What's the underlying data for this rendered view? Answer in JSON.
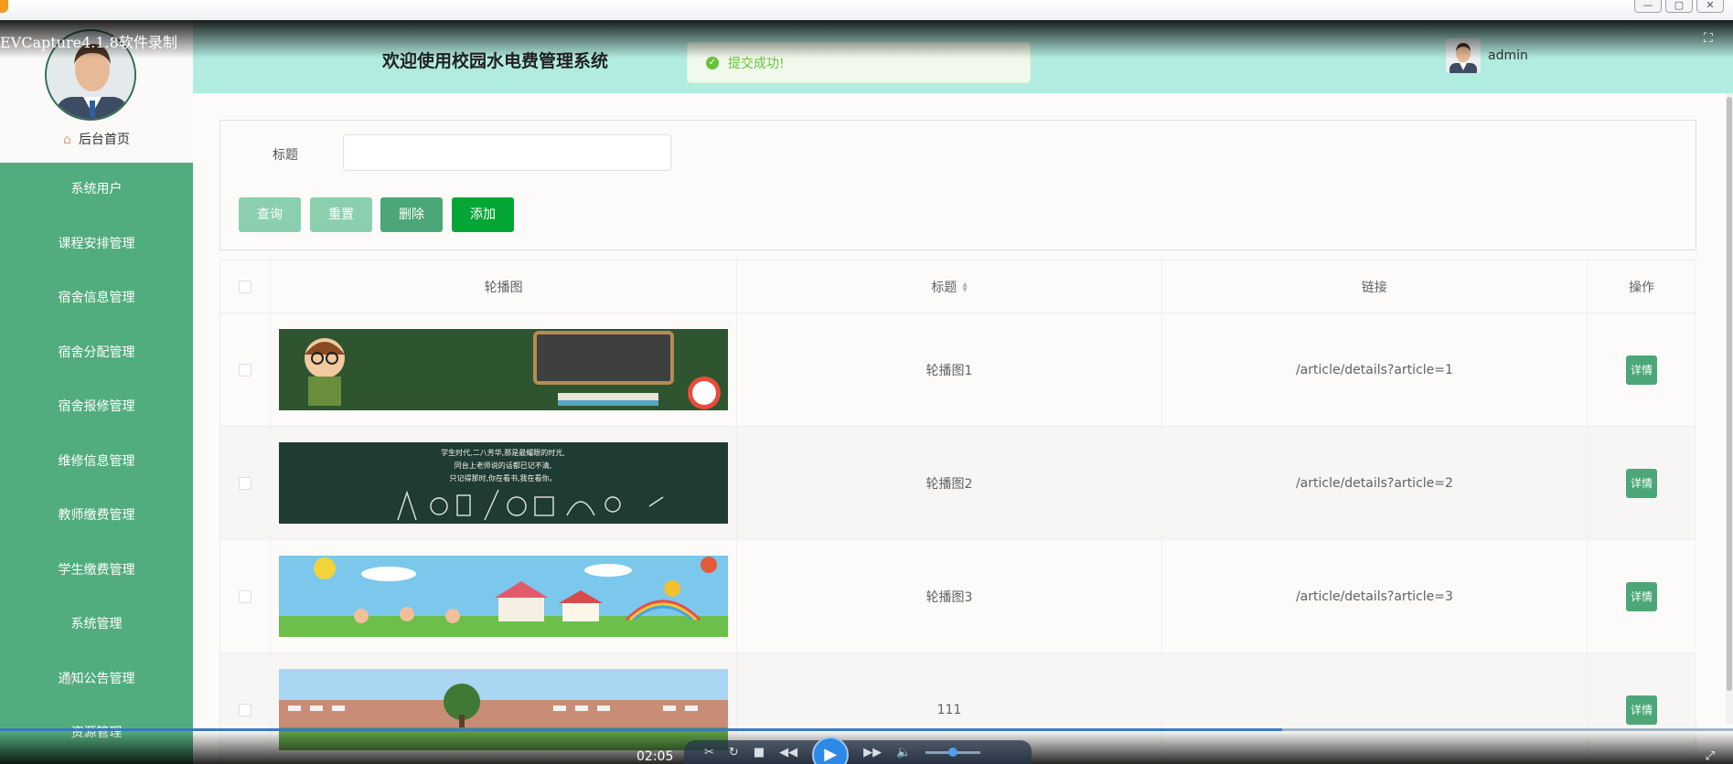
{
  "capture": {
    "title": "EVCapture4.1.8软件录制",
    "time": "02:05",
    "progress_percent": 74,
    "volume_percent": 50
  },
  "header": {
    "title": "欢迎使用校园水电费管理系统",
    "username": "admin"
  },
  "toast": {
    "message": "提交成功!"
  },
  "sidebar": {
    "home_label": "后台首页",
    "items": [
      {
        "label": "系统用户"
      },
      {
        "label": "课程安排管理"
      },
      {
        "label": "宿舍信息管理"
      },
      {
        "label": "宿舍分配管理"
      },
      {
        "label": "宿舍报修管理"
      },
      {
        "label": "维修信息管理"
      },
      {
        "label": "教师缴费管理"
      },
      {
        "label": "学生缴费管理"
      },
      {
        "label": "系统管理"
      },
      {
        "label": "通知公告管理"
      },
      {
        "label": "资源管理"
      }
    ]
  },
  "filter": {
    "title_label": "标题",
    "title_value": "",
    "buttons": {
      "query": "查询",
      "reset": "重置",
      "delete": "删除",
      "add": "添加"
    }
  },
  "table": {
    "columns": {
      "image": "轮播图",
      "title": "标题",
      "link": "链接",
      "ops": "操作"
    },
    "detail_label": "详情",
    "rows": [
      {
        "title": "轮播图1",
        "link": "/article/details?article=1"
      },
      {
        "title": "轮播图2",
        "link": "/article/details?article=2"
      },
      {
        "title": "轮播图3",
        "link": "/article/details?article=3"
      },
      {
        "title": "111",
        "link": ""
      }
    ],
    "banner2_lines": [
      "学生时代,二八芳华,那是最耀眼的时光,",
      "同台上老师说的话都已记不清,",
      "只记得那时,你在看书,我在看你。"
    ]
  },
  "colors": {
    "sidebar": "#52ad7e",
    "header": "#b2ece0",
    "primary_button": "#4ba777",
    "add_button": "#04a635",
    "toast_text": "#67c23a"
  }
}
